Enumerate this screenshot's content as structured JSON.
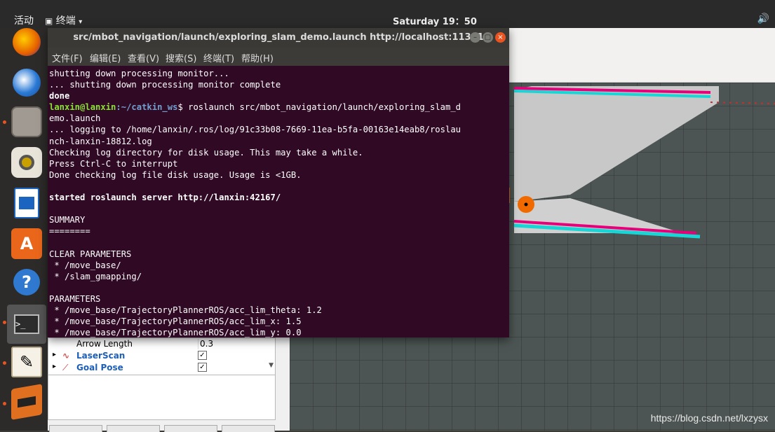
{
  "topbar": {
    "activities": "活动",
    "app_menu": "终端",
    "clock": "Saturday 19：50"
  },
  "terminal": {
    "title": "src/mbot_navigation/launch/exploring_slam_demo.launch http://localhost:11311",
    "menu": [
      "文件(F)",
      "编辑(E)",
      "查看(V)",
      "搜索(S)",
      "终端(T)",
      "帮助(H)"
    ],
    "lines": {
      "l1": "shutting down processing monitor...",
      "l2": "... shutting down processing monitor complete",
      "l3": "done",
      "prompt_user": "lanxin@lanxin",
      "prompt_path": ":~/catkin_ws",
      "prompt_cmd": "$ roslaunch src/mbot_navigation/launch/exploring_slam_d",
      "l5": "emo.launch",
      "l6": "... logging to /home/lanxin/.ros/log/91c33b08-7669-11ea-b5fa-00163e14eab8/roslau",
      "l7": "nch-lanxin-18812.log",
      "l8": "Checking log directory for disk usage. This may take a while.",
      "l9": "Press Ctrl-C to interrupt",
      "l10": "Done checking log file disk usage. Usage is <1GB.",
      "l11": "",
      "l12": "started roslaunch server http://lanxin:42167/",
      "l13": "",
      "l14": "SUMMARY",
      "l15": "========",
      "l16": "",
      "l17": "CLEAR PARAMETERS",
      "l18": " * /move_base/",
      "l19": " * /slam_gmapping/",
      "l20": "",
      "l21": "PARAMETERS",
      "l22": " * /move_base/TrajectoryPlannerROS/acc_lim_theta: 1.2",
      "l23": " * /move_base/TrajectoryPlannerROS/acc_lim_x: 1.5",
      "l24": " * /move_base/TrajectoryPlannerROS/acc_lim_y: 0.0"
    }
  },
  "displays": {
    "arrow_length_label": "Arrow Length",
    "arrow_length_value": "0.3",
    "laserscan_label": "LaserScan",
    "goalpose_label": "Goal Pose",
    "check": "✓"
  },
  "watermark": "https://blog.csdn.net/lxzysx",
  "colors": {
    "terminal_bg": "#300a24",
    "prompt_user": "#8ae234",
    "prompt_path": "#729fcf",
    "accent": "#e95420"
  }
}
